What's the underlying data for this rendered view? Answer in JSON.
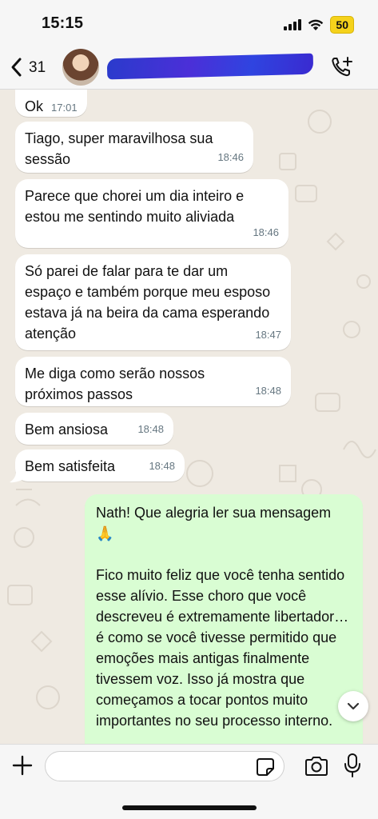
{
  "status_bar": {
    "time": "15:15",
    "battery": "50",
    "icons": [
      "signal-icon",
      "wifi-icon",
      "battery-icon"
    ]
  },
  "header": {
    "unread_count": "31",
    "contact_name": "",
    "icons": [
      "back-chevron-icon",
      "add-call-icon"
    ]
  },
  "messages": [
    {
      "direction": "in",
      "text": "Ok",
      "time": "17:01"
    },
    {
      "direction": "in",
      "text": "Tiago, super maravilhosa sua sessão",
      "time": "18:46"
    },
    {
      "direction": "in",
      "text": "Parece que chorei um dia inteiro e estou me sentindo muito aliviada",
      "time": "18:46"
    },
    {
      "direction": "in",
      "text": "Só parei de falar para te dar um espaço e também porque meu esposo estava já na beira da cama esperando atenção",
      "time": "18:47"
    },
    {
      "direction": "in",
      "text": "Me diga como serão nossos próximos passos",
      "time": "18:48"
    },
    {
      "direction": "in",
      "text": "Bem ansiosa",
      "time": "18:48"
    },
    {
      "direction": "in",
      "text": "Bem satisfeita",
      "time": "18:48"
    },
    {
      "direction": "out",
      "text": "Nath! Que alegria ler sua mensagem 🙏\n\nFico muito feliz que você tenha sentido esse alívio. Esse choro que você descreveu é extremamente libertador… é como se você tivesse permitido que emoções mais antigas finalmente tivessem voz. Isso já mostra que começamos a tocar pontos muito importantes no seu processo interno."
    }
  ],
  "input_bar": {
    "placeholder": "",
    "icons": [
      "plus-icon",
      "sticker-icon",
      "camera-icon",
      "microphone-icon"
    ]
  },
  "colors": {
    "wallpaper": "#efeae2",
    "incoming_bubble": "#ffffff",
    "outgoing_bubble": "#d9fdd3",
    "timestamp": "#667781",
    "battery": "#f5d21b"
  }
}
